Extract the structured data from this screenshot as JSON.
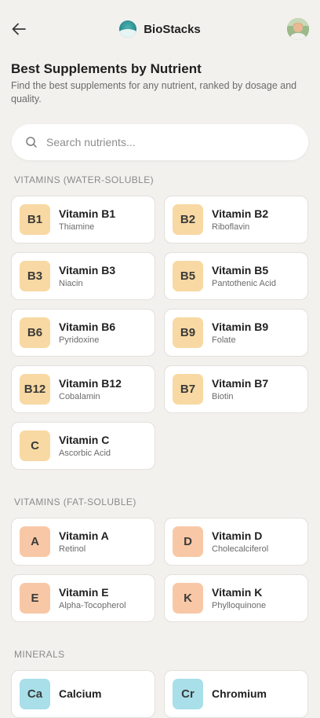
{
  "header": {
    "brand": "BioStacks"
  },
  "page": {
    "title": "Best Supplements by Nutrient",
    "subtitle": "Find the best supplements for any nutrient, ranked by dosage and quality."
  },
  "search": {
    "placeholder": "Search nutrients..."
  },
  "sections": [
    {
      "label": "VITAMINS (WATER-SOLUBLE)",
      "color": "#f8d9a3",
      "items": [
        {
          "symbol": "B1",
          "name": "Vitamin B1",
          "sub": "Thiamine"
        },
        {
          "symbol": "B2",
          "name": "Vitamin B2",
          "sub": "Riboflavin"
        },
        {
          "symbol": "B3",
          "name": "Vitamin B3",
          "sub": "Niacin"
        },
        {
          "symbol": "B5",
          "name": "Vitamin B5",
          "sub": "Pantothenic Acid"
        },
        {
          "symbol": "B6",
          "name": "Vitamin B6",
          "sub": "Pyridoxine"
        },
        {
          "symbol": "B9",
          "name": "Vitamin B9",
          "sub": "Folate"
        },
        {
          "symbol": "B12",
          "name": "Vitamin B12",
          "sub": "Cobalamin"
        },
        {
          "symbol": "B7",
          "name": "Vitamin B7",
          "sub": "Biotin"
        },
        {
          "symbol": "C",
          "name": "Vitamin C",
          "sub": "Ascorbic Acid"
        }
      ]
    },
    {
      "label": "VITAMINS (FAT-SOLUBLE)",
      "color": "#f8c8a6",
      "items": [
        {
          "symbol": "A",
          "name": "Vitamin A",
          "sub": "Retinol"
        },
        {
          "symbol": "D",
          "name": "Vitamin D",
          "sub": "Cholecalciferol"
        },
        {
          "symbol": "E",
          "name": "Vitamin E",
          "sub": "Alpha-Tocopherol"
        },
        {
          "symbol": "K",
          "name": "Vitamin K",
          "sub": "Phylloquinone"
        }
      ]
    },
    {
      "label": "MINERALS",
      "color": "#a8dfe9",
      "items": [
        {
          "symbol": "Ca",
          "name": "Calcium",
          "sub": ""
        },
        {
          "symbol": "Cr",
          "name": "Chromium",
          "sub": ""
        }
      ]
    }
  ],
  "icons": {
    "back": "arrow-left-icon",
    "search": "search-icon",
    "logo": "biostacks-logo-icon",
    "avatar": "user-avatar"
  }
}
